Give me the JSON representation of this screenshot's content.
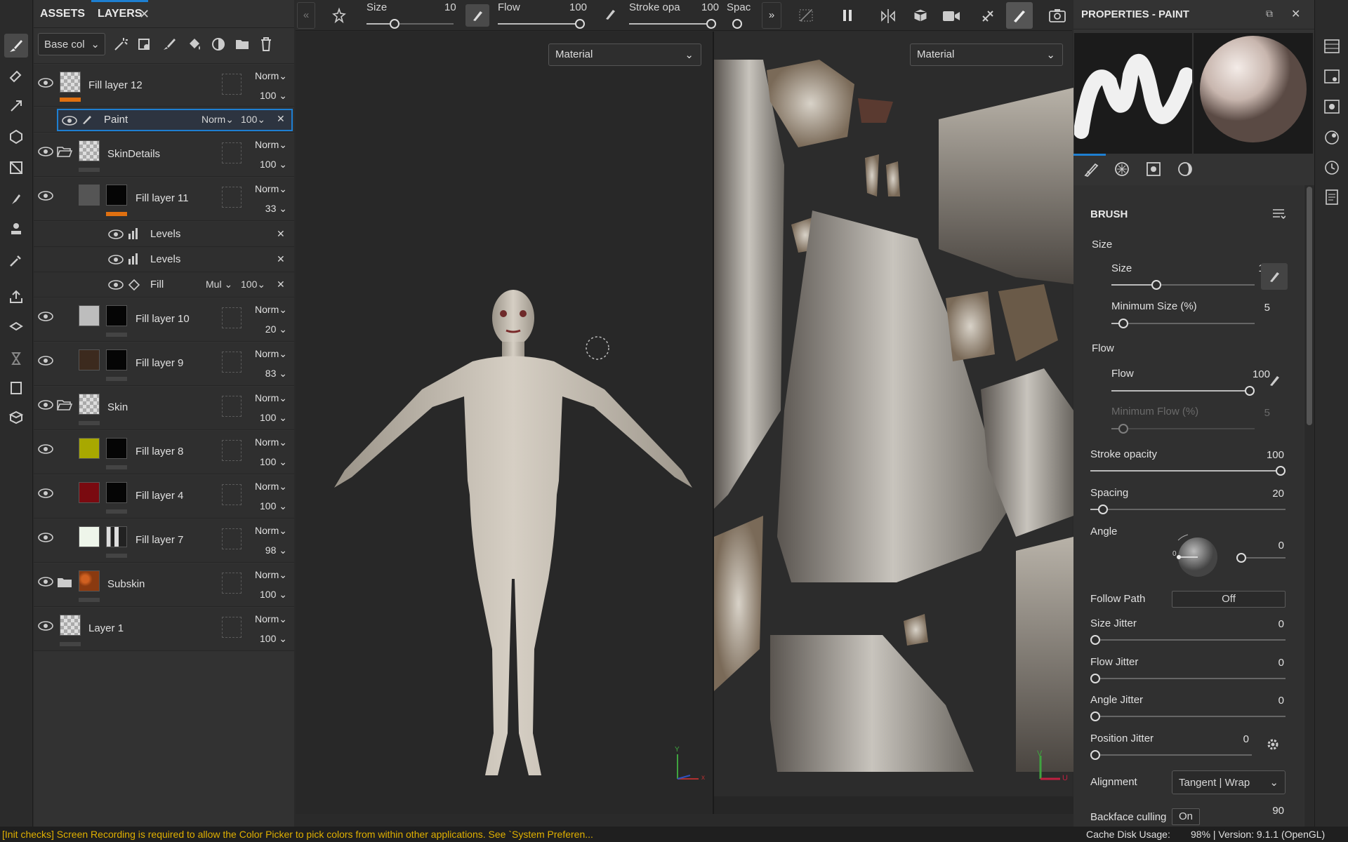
{
  "layers_panel": {
    "tabs": [
      "ASSETS",
      "LAYERS"
    ],
    "channel": "Base col",
    "layers": [
      {
        "name": "Fill layer 12",
        "blend": "Norm",
        "opacity": "100"
      },
      {
        "name": "Paint",
        "blend": "Norm",
        "opacity": "100"
      },
      {
        "name": "SkinDetails",
        "blend": "Norm",
        "opacity": "100"
      },
      {
        "name": "Fill layer 11",
        "blend": "Norm",
        "opacity": "33"
      },
      {
        "name": "Levels"
      },
      {
        "name": "Levels"
      },
      {
        "name": "Fill",
        "blend": "Mul",
        "opacity": "100"
      },
      {
        "name": "Fill layer 10",
        "blend": "Norm",
        "opacity": "20"
      },
      {
        "name": "Fill layer 9",
        "blend": "Norm",
        "opacity": "83"
      },
      {
        "name": "Skin",
        "blend": "Norm",
        "opacity": "100"
      },
      {
        "name": "Fill layer 8",
        "blend": "Norm",
        "opacity": "100"
      },
      {
        "name": "Fill layer 4",
        "blend": "Norm",
        "opacity": "100"
      },
      {
        "name": "Fill layer 7",
        "blend": "Norm",
        "opacity": "98"
      },
      {
        "name": "Subskin",
        "blend": "Norm",
        "opacity": "100"
      },
      {
        "name": "Layer 1",
        "blend": "Norm",
        "opacity": "100"
      }
    ]
  },
  "top_toolbar": {
    "size_label": "Size",
    "size_value": "10",
    "size_level": 0.3,
    "flow_label": "Flow",
    "flow_value": "100",
    "flow_level": 1.0,
    "stroke_label": "Stroke opa",
    "stroke_value": "100",
    "stroke_level": 1.0,
    "spacing_label": "Spac"
  },
  "viewports": {
    "left_material": "Material",
    "right_material": "Material",
    "axis_x": "x",
    "axis_y": "Y",
    "axis_u": "U",
    "axis_v": "V"
  },
  "properties": {
    "title": "PROPERTIES - PAINT",
    "brush_header": "BRUSH",
    "size_group": "Size",
    "size_label": "Size",
    "size_value": "10",
    "size_level": 0.3,
    "min_size_label": "Minimum Size (%)",
    "min_size_value": "5",
    "min_size_level": 0.05,
    "flow_group": "Flow",
    "flow_label": "Flow",
    "flow_value": "100",
    "flow_level": 1.0,
    "min_flow_label": "Minimum Flow (%)",
    "min_flow_value": "5",
    "min_flow_level": 0.05,
    "stroke_opacity_label": "Stroke opacity",
    "stroke_opacity_value": "100",
    "stroke_opacity_level": 1.0,
    "spacing_label": "Spacing",
    "spacing_value": "20",
    "spacing_level": 0.04,
    "angle_label": "Angle",
    "angle_value": "0",
    "angle_dial_value": "0",
    "follow_path_label": "Follow Path",
    "follow_path_value": "Off",
    "size_jitter_label": "Size Jitter",
    "size_jitter_value": "0",
    "flow_jitter_label": "Flow Jitter",
    "flow_jitter_value": "0",
    "angle_jitter_label": "Angle Jitter",
    "angle_jitter_value": "0",
    "position_jitter_label": "Position Jitter",
    "position_jitter_value": "0",
    "alignment_label": "Alignment",
    "alignment_value": "Tangent | Wrap",
    "backface_label": "Backface culling",
    "backface_value": "On",
    "backface_angle": "90"
  },
  "status": {
    "message": "[Init checks] Screen Recording is required to allow the Color Picker to pick colors from within other applications. See `System Preferen...",
    "cache_label": "Cache Disk Usage:",
    "cache_value": "98% | Version: 9.1.1 (OpenGL)"
  },
  "colors": {
    "accent": "#1e7fd1",
    "orange": "#e07010",
    "status_warning": "#e0b000"
  }
}
